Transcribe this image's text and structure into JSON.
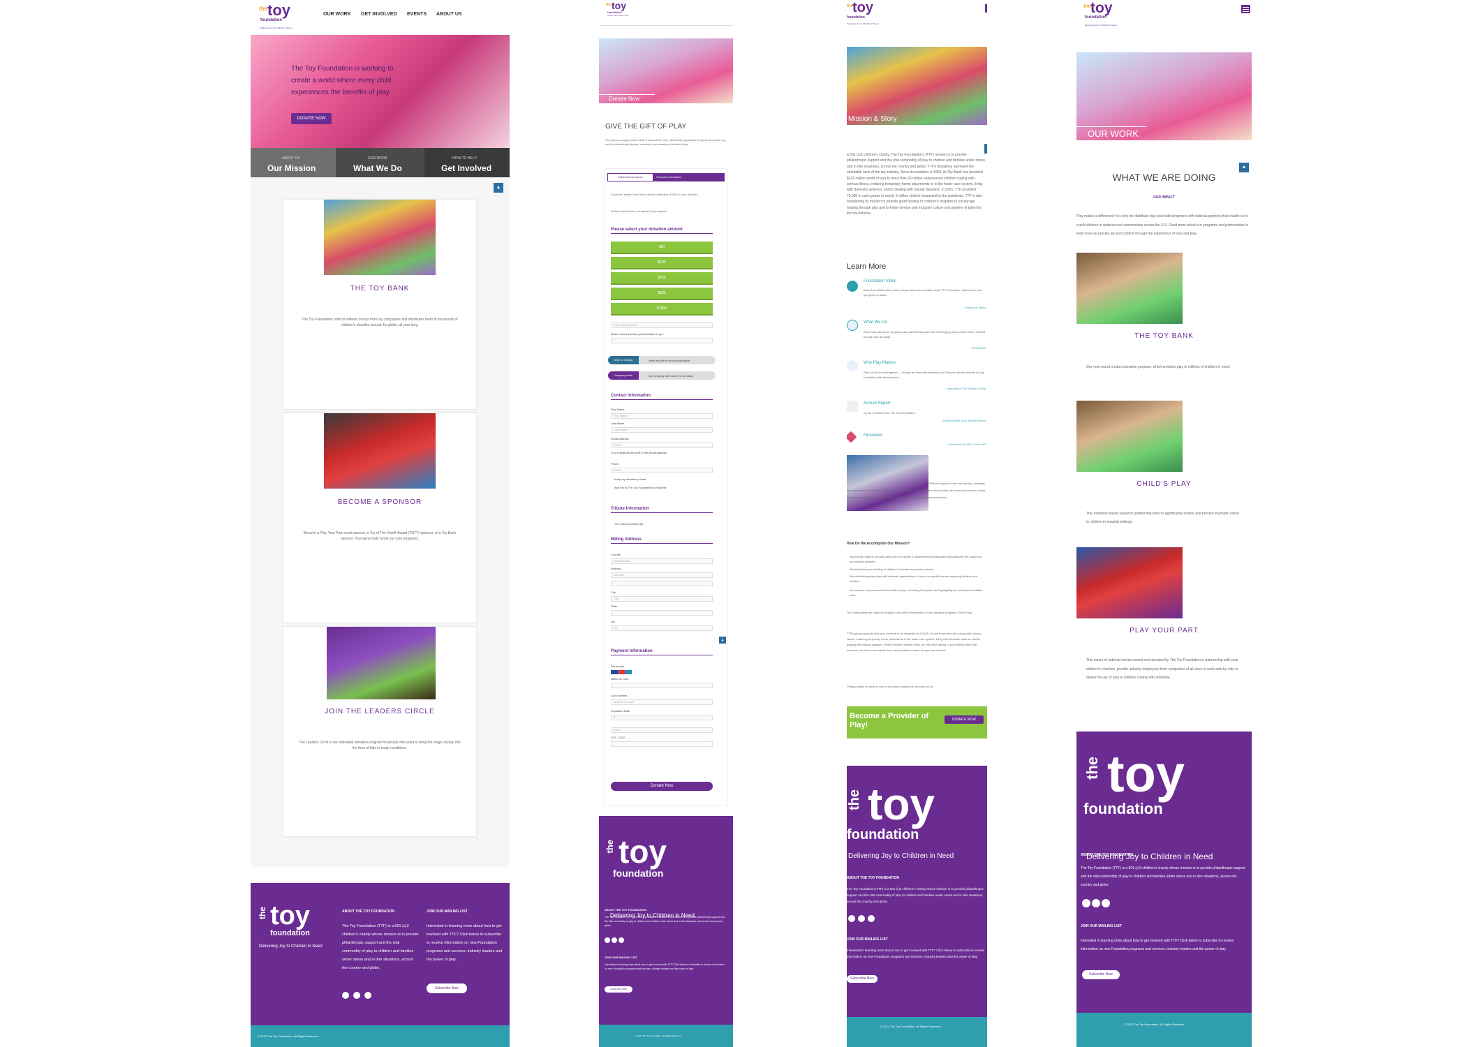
{
  "logo": {
    "the": "the",
    "toy": "toy",
    "foundation": "foundation",
    "tagline": "Delivering Joy to Children in Need",
    "tm": "TM"
  },
  "nav": [
    "OUR WORK",
    "GET INVOLVED",
    "EVENTS",
    "ABOUT US"
  ],
  "home": {
    "hero_text": "The Toy Foundation is working to create a world where every child experiences the benefits of play.",
    "donate_btn": "DONATE NOW",
    "tabs": [
      {
        "small": "ABOUT US",
        "label": "Our Mission"
      },
      {
        "small": "OUR WORK",
        "label": "What We Do"
      },
      {
        "small": "HOW TO HELP",
        "label": "Get Involved"
      }
    ],
    "cards": [
      {
        "title": "THE TOY BANK",
        "text": "The Toy Foundation collects millions of toys from toy companies and distributes them to thousands of children's charities around the globe, all year long."
      },
      {
        "title": "BECOME A SPONSOR",
        "text": "Become a Play Your Part event sponsor, a Toy of The Year® Award (TOTY) sponsor, or a Toy Bank sponsor. Your generosity funds our core programs."
      },
      {
        "title": "JOIN THE LEADERS CIRCLE",
        "text": "The Leaders Circle is our individual donation program for people who want to bring the magic of play into the lives of kids in tough conditions."
      }
    ]
  },
  "footer": {
    "about_heading": "ABOUT THE TOY FOUNDATION",
    "about_text": "The Toy Foundation (TTF) is a 501 (c)3 children's charity whose mission is to provide philanthropic support and the vital commodity of play to children and families under stress and in dire situations, across the country and globe.",
    "mailing_heading": "JOIN OUR MAILING LIST",
    "mailing_text": "Interested in learning more about how to get involved with TTF? Click below to subscribe to receive information on new Foundation programs and services, industry leaders and the power of play.",
    "subscribe": "Subscribe Now",
    "copyright": "© 2022 The Toy Foundation. All Rights Reserved."
  },
  "donate": {
    "hero_label": "Donate Now",
    "heading": "GIVE THE GIFT OF PLAY",
    "intro": "Your generous support helps create a world where every child has the opportunity to experience comfort, joy, and the extraordinary physical, emotional, and educational benefits of play.",
    "tab1": "Individual Donations",
    "tab2": "Company Donations",
    "leaders_note": "To join the Leaders Circle with an annual contribution of $250 or more, click here.",
    "required_note": "All fields marked with a red asterisk (*) are required.",
    "select_heading": "Please select your donation amount",
    "amounts": [
      "$50",
      "$100",
      "$250",
      "$500",
      "$1000"
    ],
    "other_placeholder": "Enter other amount",
    "where_label": "Where would you like your donation to go?",
    "recurring_badge": "Keep on Helping",
    "recurring_text": "Make my gift a recurring donation",
    "match_badge": "Company match",
    "match_text": "My company will match my donation",
    "contact_heading": "Contact Information",
    "first_name": "First Name",
    "last_name": "Last Name",
    "email": "Email Address",
    "email_ph": "Email",
    "receipt_note": "Your receipt will be sent to this email address",
    "phone": "Phone",
    "private": "Keep my donation private",
    "add_list": "Add me to The Toy Foundation's email list",
    "tribute_heading": "Tribute Information",
    "tribute_opt": "Yes, this is a tribute gift",
    "billing_heading": "Billing Address",
    "country": "Country",
    "country_val": "United States",
    "address": "Address",
    "city": "City",
    "state": "State",
    "zip": "Zip",
    "payment_heading": "Payment Information",
    "we_accept": "We accept",
    "name_on_card": "Name on card",
    "card_number": "Card number",
    "card_ph": "Number on card",
    "exp": "Expiration Date",
    "month": "01",
    "year": "2023",
    "cvc": "CVC / CVV",
    "submit": "Donate Now"
  },
  "mission": {
    "hero_label": "Mission & Story",
    "body": "a 501 (c)3 children's charity, The Toy Foundation's (TTF) mission is to provide philanthropic support and the vital commodity of play to children and families under stress and in dire situations, across the country and globe. TTF's donations represent the charitable work of the toy industry. Since its inception in 2003, its Toy Bank has provided $225 million worth of toys to more than 26 million underserved children coping with serious illness, enduring temporary home placements or in the foster care system, living with domestic violence, and/or dealing with natural disasters. In 2021, TTF provided 75,000 in cash grants to nearly 3 million children impacted by the pandemic. TTF is also broadening its mission to provide grant funding to children's hospitals to encourage healing through play and to foster diverse and inclusive culture and pipeline of talent for the toy industry.",
    "learn_heading": "Learn More",
    "items": [
      {
        "title": "Foundation Video",
        "text": "More than $225 million worth of toys have been donated since TTF's inception. Click here to see our giving in action.",
        "link": "› Watch the Video"
      },
      {
        "title": "What We Do",
        "text": "Read more about our programs and partnerships and how we bring joy and comfort where needed through toys and play.",
        "link": "› Read More"
      },
      {
        "title": "Why Play Matters",
        "text": "Play isn't all fun and games — it's also an important teaching tool! Discover all the benefits of play to healthy child development.",
        "link": "› Learn about The Genius of Play"
      },
      {
        "title": "Annual Report",
        "text": "A year in review from The Toy Foundation.",
        "link": "› Download the 2022 Annual Report"
      },
      {
        "title": "Financials",
        "text": "",
        "link": "› Download the 2021 Form 990"
      }
    ],
    "support_text": "With the support of the toy industry, including toy manufacturers, retailers, distributors, and licensors, The Toy Bank has provided an enormous amount of toys to more than 26 million children around the globe, thanks to our generous donors.",
    "how_heading": "How Do We Accomplish Our Mission?",
    "bullets": [
      "We provide millions of brand-new toys for children in underserved communities annually with the support of our industry partners.",
      "We distribute grant funding to children's charities across the country.",
      "We establish partnerships with national organizations to focus on specific issues impacting children and families.",
      "We research and promote the benefits of play, educating the public and highlighting the industry's charitable work."
    ],
    "cash_note": "Our Cash grants are made by invitation only with the exception of our signature program, Child's Play.",
    "covid_text": "TTF's giving supports kids who continue to be impacted by COVID-19 and those who are coping with serious illness, enduring temporary home placements in the foster care system, living with domestic violence, and/or dealing with natural disasters. When children receive a new toy, they feel special. A toy reminds them that someone out there cares about them and provides a sense of hope and comfort.",
    "smile_text": "Putting smiles on faces is one of the many reasons we do what we do.",
    "cta": "Become a Provider of Play!",
    "cta_btn": "DONATE NOW"
  },
  "work": {
    "hero_label": "OUR WORK",
    "heading": "WHAT WE ARE DOING",
    "sub": "OUR IMPACT",
    "intro": "Play makes a difference! It is why we distribute toys and build programs with national partners that enable us to reach children in underserved communities across the U.S. Read more about our programs and partnerships to learn how we provide joy and comfort through the experience of toys and play.",
    "items": [
      {
        "title": "THE TOY BANK",
        "text": "Our year-round product donation program, which provides play to millions of children in need."
      },
      {
        "title": "CHILD'S PLAY",
        "text": "This evidence-based research partnership aims to significantly reduce and prevent traumatic stress in children in hospital settings."
      },
      {
        "title": "PLAY YOUR PART",
        "text": "This series of national events owned and operated by The Toy Foundation in partnership with local children's charities, provide industry employees from companies of all sizes to work side-by-side to deliver the joy of play to children coping with adversity."
      }
    ]
  },
  "colors": {
    "purple": "#6a2c91",
    "teal": "#2f9fb0",
    "green": "#8cc63f",
    "orange": "#f5a623"
  }
}
